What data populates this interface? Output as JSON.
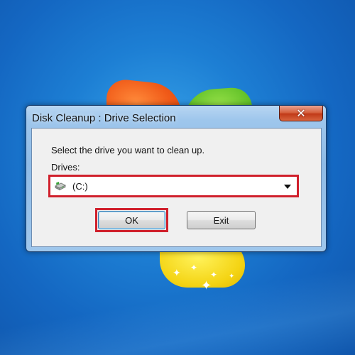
{
  "window": {
    "title": "Disk Cleanup : Drive Selection",
    "close_glyph": "✕"
  },
  "dialog": {
    "prompt": "Select the drive you want to clean up.",
    "drives_label": "Drives:",
    "selected_drive": "(C:)",
    "drive_icon": "hard-drive-icon",
    "dropdown_icon": "chevron-down-icon",
    "ok_label": "OK",
    "exit_label": "Exit"
  },
  "annotations": {
    "highlight_color": "#d0202c"
  }
}
